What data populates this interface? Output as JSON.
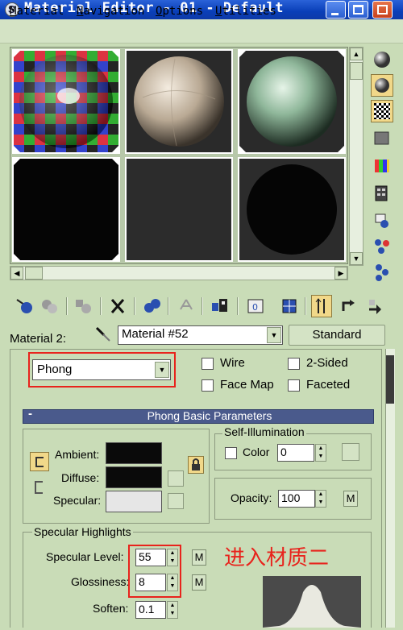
{
  "window": {
    "title": "Material Editor - 01 - Default"
  },
  "menu": {
    "items": [
      {
        "label": "Material",
        "mnemonic": "M"
      },
      {
        "label": "Navigation",
        "mnemonic": "N"
      },
      {
        "label": "Options",
        "mnemonic": "O"
      },
      {
        "label": "Utilities",
        "mnemonic": "U"
      }
    ]
  },
  "sample_slots": [
    {
      "kind": "checker-sphere"
    },
    {
      "kind": "beige-sphere"
    },
    {
      "kind": "green-sphere"
    },
    {
      "kind": "empty"
    },
    {
      "kind": "empty-dim"
    },
    {
      "kind": "black-sphere"
    }
  ],
  "material": {
    "slot_label": "Material 2:",
    "name": "Material #52",
    "type_button": "Standard"
  },
  "shader": {
    "selected": "Phong",
    "options": {
      "wire": "Wire",
      "two_sided": "2-Sided",
      "face_map": "Face Map",
      "faceted": "Faceted"
    }
  },
  "basic_params": {
    "rollout_title": "Phong Basic Parameters",
    "rollout_toggle": "-",
    "ambient_label": "Ambient:",
    "diffuse_label": "Diffuse:",
    "specular_label": "Specular:",
    "ambient_color": "#0a0a0a",
    "diffuse_color": "#0a0a0a",
    "specular_color": "#e6e6e6",
    "self_illum": {
      "group_label": "Self-Illumination",
      "color_label": "Color",
      "value": "0"
    },
    "opacity": {
      "label": "Opacity:",
      "value": "100",
      "map_button": "M"
    }
  },
  "specular_highlights": {
    "group_label": "Specular Highlights",
    "specular_level_label": "Specular Level:",
    "specular_level": "55",
    "glossiness_label": "Glossiness:",
    "glossiness": "8",
    "soften_label": "Soften:",
    "soften": "0.1",
    "map_button": "M"
  },
  "annotation": {
    "text": "进入材质二",
    "color": "#e8231c"
  }
}
